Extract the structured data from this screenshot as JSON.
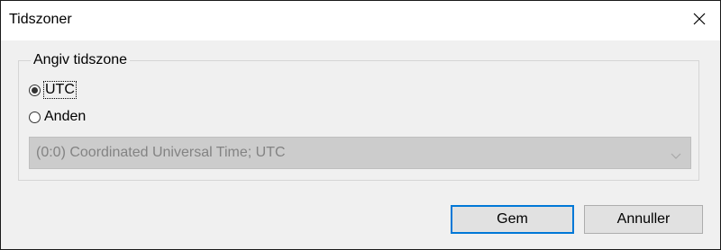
{
  "dialog": {
    "title": "Tidszoner",
    "close_icon": "close-icon"
  },
  "group": {
    "legend": "Angiv tidszone",
    "options": [
      {
        "label": "UTC",
        "selected": true,
        "focused": true
      },
      {
        "label": "Anden",
        "selected": false,
        "focused": false
      }
    ]
  },
  "timezone_select": {
    "value": "(0:0) Coordinated Universal Time; UTC",
    "enabled": false,
    "icon": "chevron-down-icon"
  },
  "buttons": {
    "save_label": "Gem",
    "cancel_label": "Annuller"
  },
  "colors": {
    "accent": "#0078d7",
    "dialog_bg": "#f0f0f0",
    "disabled_select_bg": "#cccccc",
    "disabled_text": "#838383"
  }
}
